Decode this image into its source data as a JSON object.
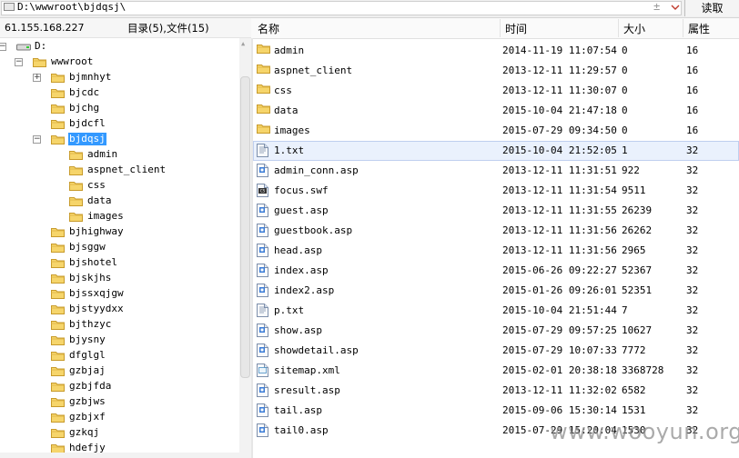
{
  "address_bar": {
    "path": "D:\\wwwroot\\bjdqsj\\",
    "plus": "±",
    "read_button": "读取"
  },
  "status": {
    "ip": "61.155.168.227",
    "dir_info": "目录(5),文件(15)"
  },
  "columns": {
    "name": "名称",
    "time": "时间",
    "size": "大小",
    "attr": "属性"
  },
  "tree": {
    "drive": "D:",
    "wwwroot": "wwwroot",
    "items": [
      {
        "label": "bjmnhyt",
        "expander": "+"
      },
      {
        "label": "bjcdc",
        "expander": ""
      },
      {
        "label": "bjchg",
        "expander": ""
      },
      {
        "label": "bjdcfl",
        "expander": ""
      },
      {
        "label": "bjdqsj",
        "expander": "−",
        "selected": true,
        "children": [
          "admin",
          "aspnet_client",
          "css",
          "data",
          "images"
        ]
      },
      {
        "label": "bjhighway",
        "expander": ""
      },
      {
        "label": "bjsggw",
        "expander": ""
      },
      {
        "label": "bjshotel",
        "expander": ""
      },
      {
        "label": "bjskjhs",
        "expander": ""
      },
      {
        "label": "bjssxqjgw",
        "expander": ""
      },
      {
        "label": "bjstyydxx",
        "expander": ""
      },
      {
        "label": "bjthzyc",
        "expander": ""
      },
      {
        "label": "bjysny",
        "expander": ""
      },
      {
        "label": "dfglgl",
        "expander": ""
      },
      {
        "label": "gzbjaj",
        "expander": ""
      },
      {
        "label": "gzbjfda",
        "expander": ""
      },
      {
        "label": "gzbjws",
        "expander": ""
      },
      {
        "label": "gzbjxf",
        "expander": ""
      },
      {
        "label": "gzkqj",
        "expander": ""
      },
      {
        "label": "hdefjy",
        "expander": ""
      }
    ]
  },
  "files": [
    {
      "name": "admin",
      "time": "2014-11-19 11:07:54",
      "size": "0",
      "attr": "16",
      "icon": "folder-icon"
    },
    {
      "name": "aspnet_client",
      "time": "2013-12-11 11:29:57",
      "size": "0",
      "attr": "16",
      "icon": "folder-icon"
    },
    {
      "name": "css",
      "time": "2013-12-11 11:30:07",
      "size": "0",
      "attr": "16",
      "icon": "folder-icon"
    },
    {
      "name": "data",
      "time": "2015-10-04 21:47:18",
      "size": "0",
      "attr": "16",
      "icon": "folder-icon"
    },
    {
      "name": "images",
      "time": "2015-07-29 09:34:50",
      "size": "0",
      "attr": "16",
      "icon": "folder-icon"
    },
    {
      "name": "1.txt",
      "time": "2015-10-04 21:52:05",
      "size": "1",
      "attr": "32",
      "icon": "text-file-icon",
      "selected": true
    },
    {
      "name": "admin_conn.asp",
      "time": "2013-12-11 11:31:51",
      "size": "922",
      "attr": "32",
      "icon": "asp-file-icon"
    },
    {
      "name": "focus.swf",
      "time": "2013-12-11 11:31:54",
      "size": "9511",
      "attr": "32",
      "icon": "swf-file-icon"
    },
    {
      "name": "guest.asp",
      "time": "2013-12-11 11:31:55",
      "size": "26239",
      "attr": "32",
      "icon": "asp-file-icon"
    },
    {
      "name": "guestbook.asp",
      "time": "2013-12-11 11:31:56",
      "size": "26262",
      "attr": "32",
      "icon": "asp-file-icon"
    },
    {
      "name": "head.asp",
      "time": "2013-12-11 11:31:56",
      "size": "2965",
      "attr": "32",
      "icon": "asp-file-icon"
    },
    {
      "name": "index.asp",
      "time": "2015-06-26 09:22:27",
      "size": "52367",
      "attr": "32",
      "icon": "asp-file-icon"
    },
    {
      "name": "index2.asp",
      "time": "2015-01-26 09:26:01",
      "size": "52351",
      "attr": "32",
      "icon": "asp-file-icon"
    },
    {
      "name": "p.txt",
      "time": "2015-10-04 21:51:44",
      "size": "7",
      "attr": "32",
      "icon": "text-file-icon"
    },
    {
      "name": "show.asp",
      "time": "2015-07-29 09:57:25",
      "size": "10627",
      "attr": "32",
      "icon": "asp-file-icon"
    },
    {
      "name": "showdetail.asp",
      "time": "2015-07-29 10:07:33",
      "size": "7772",
      "attr": "32",
      "icon": "asp-file-icon"
    },
    {
      "name": "sitemap.xml",
      "time": "2015-02-01 20:38:18",
      "size": "3368728",
      "attr": "32",
      "icon": "xml-file-icon"
    },
    {
      "name": "sresult.asp",
      "time": "2013-12-11 11:32:02",
      "size": "6582",
      "attr": "32",
      "icon": "asp-file-icon"
    },
    {
      "name": "tail.asp",
      "time": "2015-09-06 15:30:14",
      "size": "1531",
      "attr": "32",
      "icon": "asp-file-icon"
    },
    {
      "name": "tail0.asp",
      "time": "2015-07-29 15:20:04",
      "size": "1530",
      "attr": "32",
      "icon": "asp-file-icon"
    }
  ],
  "watermark": "www.wooyun.org",
  "colors": {
    "selection": "#3399ff",
    "row_highlight": "#eaf1fd",
    "folder": "#f6d56b"
  }
}
